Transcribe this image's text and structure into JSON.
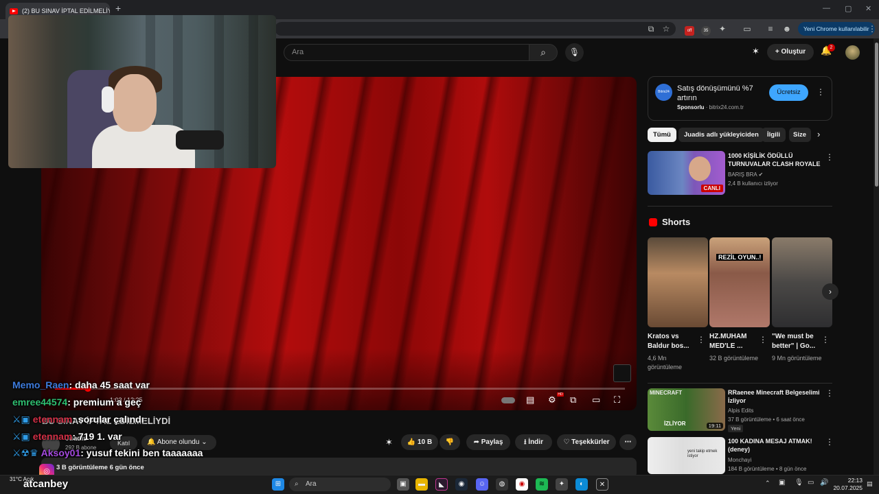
{
  "browser": {
    "tab_title": "(2) BU SINAV İPTAL EDİLMELİYDİ",
    "tab_close": "✕",
    "new_tab": "+",
    "update_label": "Yeni Chrome kullanılabilir",
    "ext_badge_1": "off",
    "ext_badge_2": "35",
    "win_min": "—",
    "win_max": "▢",
    "win_close": "✕"
  },
  "header": {
    "search_placeholder": "Ara",
    "create_label": "Oluştur",
    "notification_count": "2"
  },
  "player": {
    "time_readout": "1:03 / 12:25",
    "progress_fraction": 0.058
  },
  "video": {
    "title": "BU SINAV İPTAL EDİLMELİYDİ",
    "channel_name": "Juadis",
    "subscribers": "292 B abone",
    "join_label": "Katıl",
    "subscribed_label": "Abone olundu",
    "like_count": "10 B",
    "share_label": "Paylaş",
    "download_label": "İndir",
    "thanks_label": "Teşekkürler",
    "views_meta": "3 B görüntüleme  6 gün önce"
  },
  "ad": {
    "logo_text": "Bitrix24",
    "title": "Satış dönüşümünü %7 artırın",
    "sponsor_label": "Sponsorlu",
    "sponsor_domain": "bitrix24.com.tr",
    "cta_label": "Ücretsiz"
  },
  "chips": [
    "Tümü",
    "Juadis adlı yükleyiciden",
    "İlgili",
    "Size"
  ],
  "live_rec": {
    "title": "1000 KİŞİLİK ÖDÜLLÜ TURNUVALAR CLASH ROYALE",
    "channel": "BARIŞ BRA",
    "viewers": "2,4 B kullanıcı izliyor",
    "live_badge": "CANLI"
  },
  "shorts": {
    "section_title": "Shorts",
    "items": [
      {
        "title": "Kratos vs Baldur bos...",
        "views": "4,6 Mn görüntüleme"
      },
      {
        "title": "HZ.MUHAM MED'LE ...",
        "views": "32 B görüntüleme",
        "overlay": "REZİL OYUN..!"
      },
      {
        "title": "\"We must be better\" | Go...",
        "views": "9 Mn görüntüleme"
      }
    ]
  },
  "recs": [
    {
      "title": "RRaenee Minecraft Belgeselimi İzliyor",
      "channel": "Alpis Edits",
      "meta": "37 B görüntüleme • 6 saat önce",
      "badge": "Yeni",
      "duration": "19:11",
      "thumb_text": "İZLİYOR",
      "thumb_top": "MINECRAFT"
    },
    {
      "title": "100 KADINA MESAJ ATMAK! (deney)",
      "channel": "Monchayi",
      "meta": "184 B görüntüleme • 8 gün önce",
      "thumb_text": "yeni takip etmek istiyor"
    }
  ],
  "chat": [
    {
      "user": "Memo_Raen",
      "user_color": "#3d7bdc",
      "text": ": daha 45 saat var"
    },
    {
      "user": "emree44574",
      "user_color": "#2fbf71",
      "text": ": premium a geç"
    },
    {
      "user": "etennam",
      "user_color": "#d12f45",
      "text": ": sorular çalındı"
    },
    {
      "user": "etennam",
      "user_color": "#d12f45",
      "text": ": 719 1. var"
    },
    {
      "user": "Aksoy01",
      "user_color": "#a54ae0",
      "text": ": yusuf tekini ben taaaaaaa"
    }
  ],
  "streamer": {
    "name": "atcanbey"
  },
  "taskbar": {
    "search_label": "Ara",
    "time": "22:13",
    "date": "20.07.2025",
    "weather": "31°C Açık"
  },
  "colors": {
    "accent_red": "#ff0000",
    "cta_blue": "#3ea6ff",
    "background": "#0f0f0f"
  }
}
